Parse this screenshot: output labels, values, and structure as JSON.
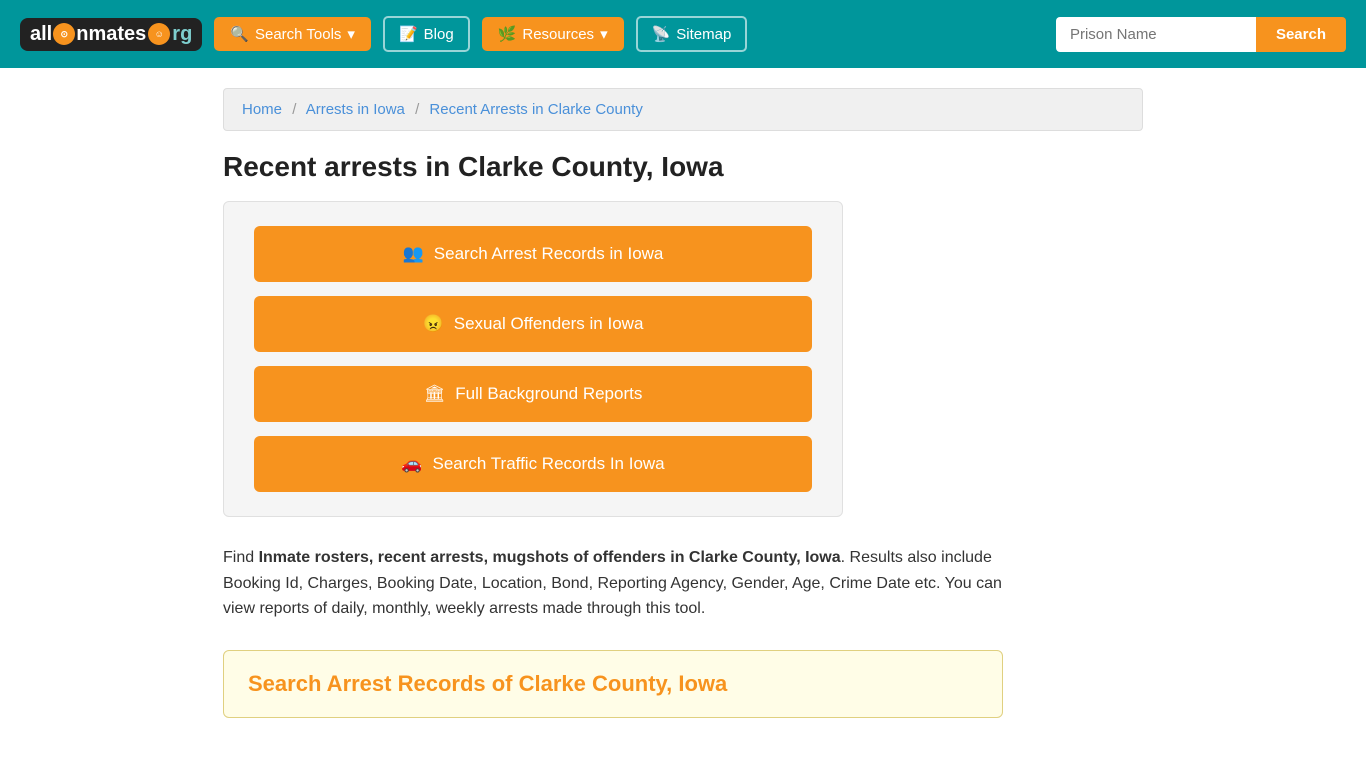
{
  "header": {
    "logo_text": "all Inmates .org",
    "nav": [
      {
        "id": "search-tools",
        "label": "Search Tools",
        "icon": "search-icon",
        "dropdown": true
      },
      {
        "id": "blog",
        "label": "Blog",
        "icon": "blog-icon",
        "dropdown": false
      },
      {
        "id": "resources",
        "label": "Resources",
        "icon": "resources-icon",
        "dropdown": true
      },
      {
        "id": "sitemap",
        "label": "Sitemap",
        "icon": "sitemap-icon",
        "dropdown": false
      }
    ],
    "prison_input_placeholder": "Prison Name",
    "search_button_label": "Search"
  },
  "breadcrumb": {
    "items": [
      {
        "label": "Home",
        "href": "#"
      },
      {
        "label": "Arrests in Iowa",
        "href": "#"
      },
      {
        "label": "Recent Arrests in Clarke County",
        "href": "#",
        "current": true
      }
    ]
  },
  "page": {
    "title": "Recent arrests in Clarke County, Iowa",
    "buttons": [
      {
        "id": "arrest-records",
        "label": "Search Arrest Records in Iowa",
        "icon": "person-icon"
      },
      {
        "id": "sexual-offenders",
        "label": "Sexual Offenders in Iowa",
        "icon": "offender-icon"
      },
      {
        "id": "background-reports",
        "label": "Full Background Reports",
        "icon": "building-icon"
      },
      {
        "id": "traffic-records",
        "label": "Search Traffic Records In Iowa",
        "icon": "car-icon"
      }
    ],
    "description_prefix": "Find ",
    "description_bold": "Inmate rosters, recent arrests, mugshots of offenders in Clarke County, Iowa",
    "description_suffix": ". Results also include Booking Id, Charges, Booking Date, Location, Bond, Reporting Agency, Gender, Age, Crime Date etc. You can view reports of daily, monthly, weekly arrests made through this tool.",
    "section_title": "Search Arrest Records of Clarke County, Iowa"
  }
}
